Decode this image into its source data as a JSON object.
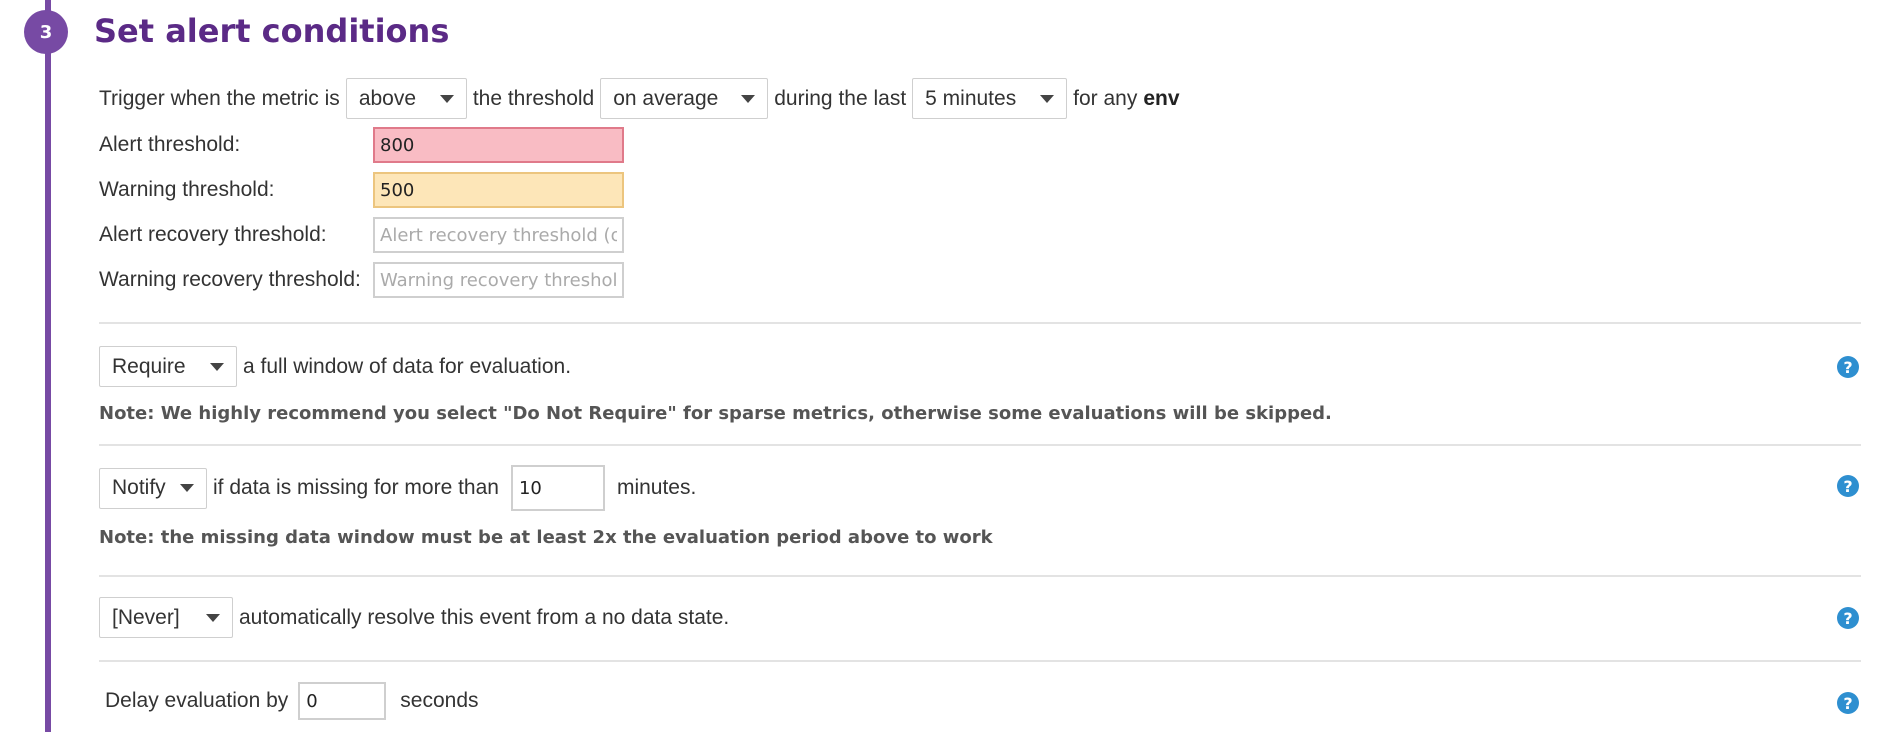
{
  "step": {
    "number": "3",
    "title": "Set alert conditions"
  },
  "trigger": {
    "text1": "Trigger when the metric is",
    "comparison": "above",
    "text2": "the threshold",
    "aggregation": "on average",
    "text3": "during the last",
    "window": "5 minutes",
    "text4": "for any",
    "group": "env"
  },
  "thresholds": {
    "alert_label": "Alert threshold:",
    "alert_value": "800",
    "warning_label": "Warning threshold:",
    "warning_value": "500",
    "alert_recovery_label": "Alert recovery threshold:",
    "alert_recovery_placeholder": "Alert recovery threshold (opt",
    "warning_recovery_label": "Warning recovery threshold:",
    "warning_recovery_placeholder": "Warning recovery threshold"
  },
  "full_window": {
    "select": "Require",
    "text": "a full window of data for evaluation.",
    "note": "Note: We highly recommend you select \"Do Not Require\" for sparse metrics, otherwise some evaluations will be skipped."
  },
  "missing_data": {
    "select": "Notify",
    "text1": "if data is missing for more than",
    "minutes": "10",
    "text2": "minutes.",
    "note": "Note: the missing data window must be at least 2x the evaluation period above to work"
  },
  "auto_resolve": {
    "select": "[Never]",
    "text": "automatically resolve this event from a no data state."
  },
  "delay": {
    "text1": "Delay evaluation by",
    "seconds": "0",
    "text2": "seconds"
  },
  "help_icon": "?",
  "colors": {
    "accent": "#774aa4",
    "title": "#5b2a86",
    "alert_bg": "#f9bcc4",
    "warning_bg": "#fde6b8",
    "help": "#2e8fd0"
  }
}
